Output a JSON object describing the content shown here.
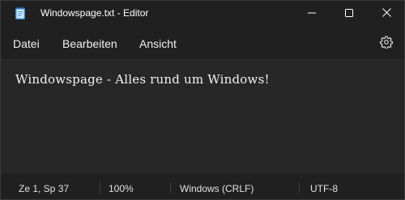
{
  "titlebar": {
    "title": "Windowspage.txt - Editor",
    "app_icon": "notepad-icon",
    "buttons": {
      "minimize": "minimize-icon",
      "maximize": "maximize-icon",
      "close": "close-icon"
    }
  },
  "menu": {
    "file": "Datei",
    "edit": "Bearbeiten",
    "view": "Ansicht",
    "settings_icon": "gear-icon"
  },
  "editor": {
    "content": "Windowspage - Alles rund um Windows!"
  },
  "status": {
    "position": "Ze 1, Sp 37",
    "zoom": "100%",
    "line_ending": "Windows (CRLF)",
    "encoding": "UTF-8"
  },
  "colors": {
    "window_bg": "#202020",
    "editor_bg": "#272727",
    "accent_icon": "#4aa3df"
  }
}
